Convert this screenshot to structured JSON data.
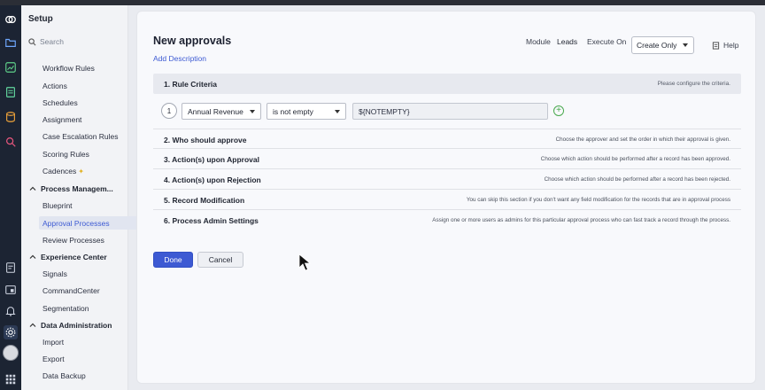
{
  "sidebar": {
    "title": "Setup",
    "search_placeholder": "Search",
    "items": [
      {
        "label": "Workflow Rules"
      },
      {
        "label": "Actions"
      },
      {
        "label": "Schedules"
      },
      {
        "label": "Assignment"
      },
      {
        "label": "Case Escalation Rules"
      },
      {
        "label": "Scoring Rules"
      },
      {
        "label": "Cadences"
      }
    ],
    "groups": {
      "process": "Process Managem...",
      "experience": "Experience Center",
      "data_admin": "Data Administration"
    },
    "process_items": [
      "Blueprint",
      "Approval Processes",
      "Review Processes"
    ],
    "experience_items": [
      "Signals",
      "CommandCenter",
      "Segmentation"
    ],
    "data_items": [
      "Import",
      "Export",
      "Data Backup"
    ]
  },
  "header": {
    "title": "New approvals",
    "add_description": "Add Description",
    "module_label": "Module",
    "module_value": "Leads",
    "execute_on_label": "Execute On",
    "execute_on_value": "Create Only",
    "help": "Help"
  },
  "criteria": {
    "section_label": "1.  Rule Criteria",
    "section_hint": "Please configure the criteria.",
    "row_number": "1",
    "field": "Annual Revenue",
    "operator": "is not empty",
    "value": "${NOTEMPTY}"
  },
  "steps": [
    {
      "label": "2.  Who should approve",
      "hint": "Choose the approver and set the order in which their approval is given."
    },
    {
      "label": "3.  Action(s) upon Approval",
      "hint": "Choose which action should be performed after a record has been approved."
    },
    {
      "label": "4.  Action(s) upon Rejection",
      "hint": "Choose which action should be performed after a record has been rejected."
    },
    {
      "label": "5.  Record Modification",
      "hint": "You can skip this section if you don't want any field modification for the records that are in approval process"
    },
    {
      "label": "6.  Process Admin Settings",
      "hint": "Assign one or more users as admins for this particular approval process who can fast track a record through the process."
    }
  ],
  "buttons": {
    "done": "Done",
    "cancel": "Cancel"
  },
  "colors": {
    "accent": "#3d5ad3",
    "rail": "#1c2433",
    "add_green": "#47a84c"
  }
}
